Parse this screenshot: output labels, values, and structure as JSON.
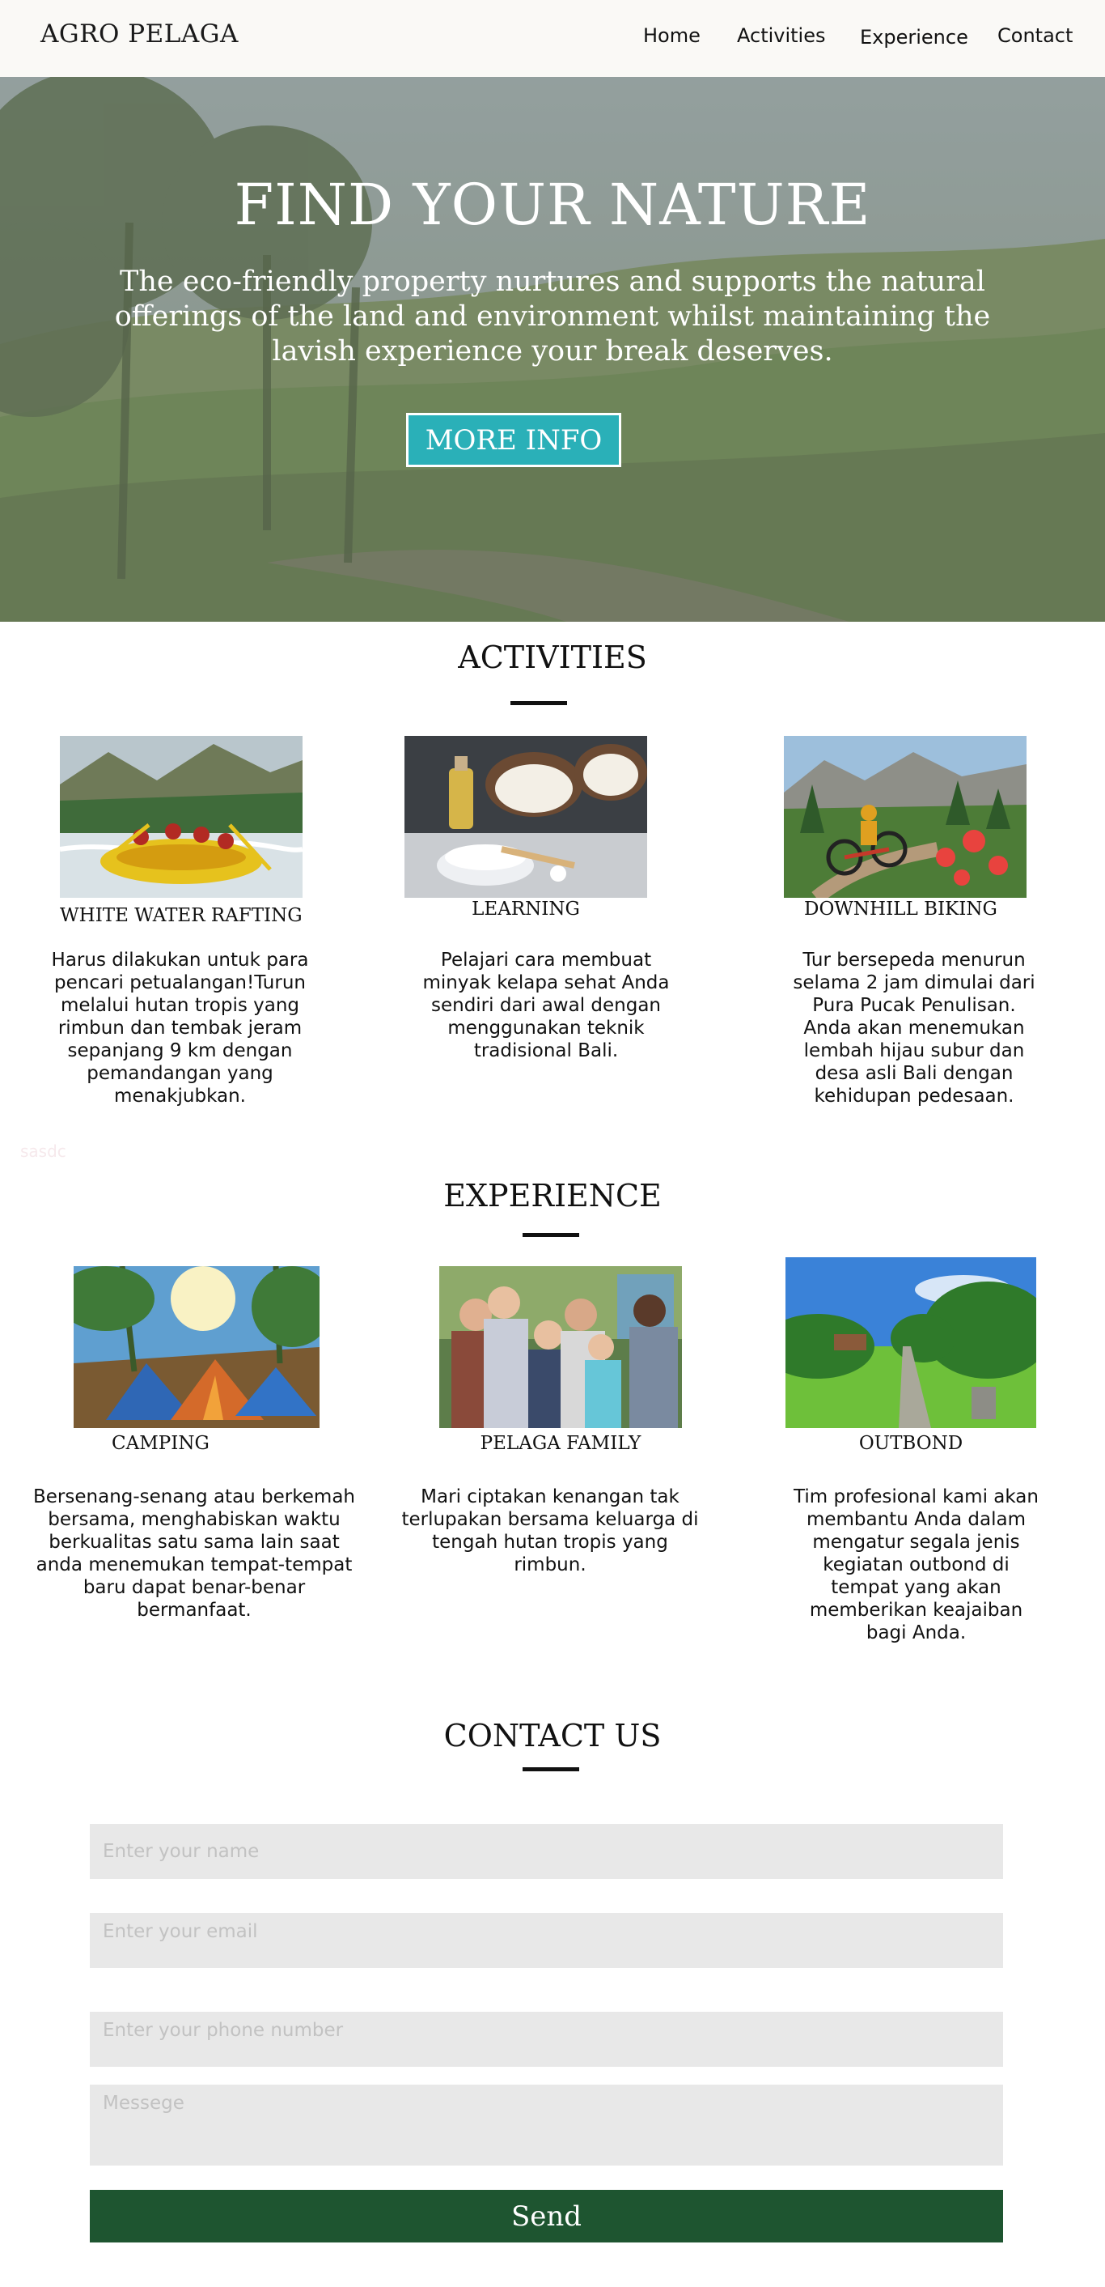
{
  "nav": {
    "brand": "AGRO PELAGA",
    "links": [
      "Home",
      "Activities",
      "Experience",
      "Contact"
    ]
  },
  "hero": {
    "title": "FIND YOUR NATURE",
    "subtitle": "The eco-friendly property nurtures and supports the natural offerings of the land and environment whilst maintaining the lavish experience your break deserves.",
    "button_label": "MORE INFO"
  },
  "activities": {
    "title": "ACTIVITIES",
    "items": [
      {
        "title": "WHITE WATER RAFTING",
        "description": "Harus dilakukan untuk para pencari petualangan!Turun melalui hutan tropis yang rimbun dan tembak jeram sepanjang 9 km dengan pemandangan yang menakjubkan.",
        "image": "rafting-photo"
      },
      {
        "title": "LEARNING",
        "description": "Pelajari cara membuat minyak kelapa sehat Anda sendiri dari awal dengan menggunakan teknik tradisional Bali.",
        "image": "coconut-oil-photo"
      },
      {
        "title": "DOWNHILL BIKING",
        "description": "Tur bersepeda menurun selama 2 jam dimulai dari Pura Pucak Penulisan. Anda akan menemukan lembah hijau subur dan desa asli Bali dengan kehidupan pedesaan.",
        "image": "biking-photo"
      }
    ]
  },
  "ghost": {
    "text": "sasdc"
  },
  "experience": {
    "title": "EXPERIENCE",
    "items": [
      {
        "title": "CAMPING",
        "description": "Bersenang-senang atau berkemah bersama, menghabiskan waktu berkualitas satu sama lain saat anda menemukan tempat-tempat baru dapat benar-benar bermanfaat.",
        "image": "camping-photo"
      },
      {
        "title": "PELAGA FAMILY",
        "description": "Mari ciptakan kenangan tak terlupakan bersama keluarga di tengah hutan tropis yang rimbun.",
        "image": "family-photo"
      },
      {
        "title": "OUTBOND",
        "description": "Tim profesional kami akan membantu Anda dalam mengatur  segala jenis kegiatan outbond di tempat yang akan memberikan keajaiban bagi Anda.",
        "image": "garden-path-photo"
      }
    ]
  },
  "contact": {
    "title": "CONTACT US",
    "name_placeholder": "Enter your name",
    "email_placeholder": "Enter your email",
    "phone_placeholder": "Enter your phone number",
    "message_placeholder": "Messege",
    "send_label": "Send"
  },
  "colors": {
    "accent": "#2ab0b8",
    "send": "#1e5530",
    "field": "#e8e8e8"
  }
}
